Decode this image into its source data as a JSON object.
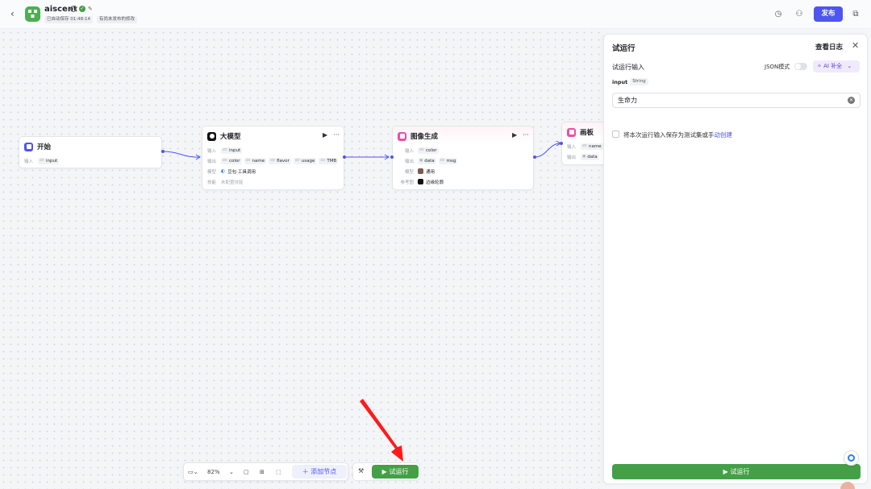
{
  "header": {
    "app_name": "aiscent",
    "autosave": "已自动保存 01:48:14",
    "unpublished": "有尚未发布的修改",
    "publish_label": "发布"
  },
  "nodes": {
    "start": {
      "title": "开始",
      "row_input_label": "输入",
      "input_tag": "input",
      "icon_color": "#4e55f0"
    },
    "llm": {
      "title": "大模型",
      "input_label": "输入",
      "input_tag": "input",
      "output_label": "输出",
      "outputs": [
        "color",
        "name",
        "flavor",
        "usage",
        "TMB"
      ],
      "model_label": "模型",
      "model_value": "豆包·工具调用",
      "skill_label": "技能",
      "skill_value": "未配置技能"
    },
    "image": {
      "title": "图像生成",
      "input_label": "输入",
      "input_tag": "color",
      "output_label": "输出",
      "outputs": [
        "data",
        "msg"
      ],
      "model_label": "模型",
      "model_value": "通用",
      "ref_label": "参考图",
      "ref_value": "边缘轮廓",
      "icon_color": "#ec4fa5"
    },
    "board": {
      "title": "画板",
      "input_label": "输入",
      "input_tag": "name",
      "output_label": "输出",
      "output_tag": "data",
      "icon_color": "#ec4fa5"
    }
  },
  "toolbar": {
    "zoom": "82%",
    "add_node": "添加节点",
    "run": "试运行"
  },
  "panel": {
    "title": "试运行",
    "view_log": "查看日志",
    "section_title": "试运行输入",
    "json_mode": "JSON模式",
    "ai_fill": "AI 补全",
    "input_name": "input",
    "input_type": "String",
    "input_value": "生命力",
    "save_text": "将本次运行输入保存为测试集或手",
    "save_link": "动创建",
    "run_button": "试运行"
  },
  "colors": {
    "accent": "#4e55f0",
    "run_green": "#43a047",
    "annotation": "#ff1a1a"
  }
}
